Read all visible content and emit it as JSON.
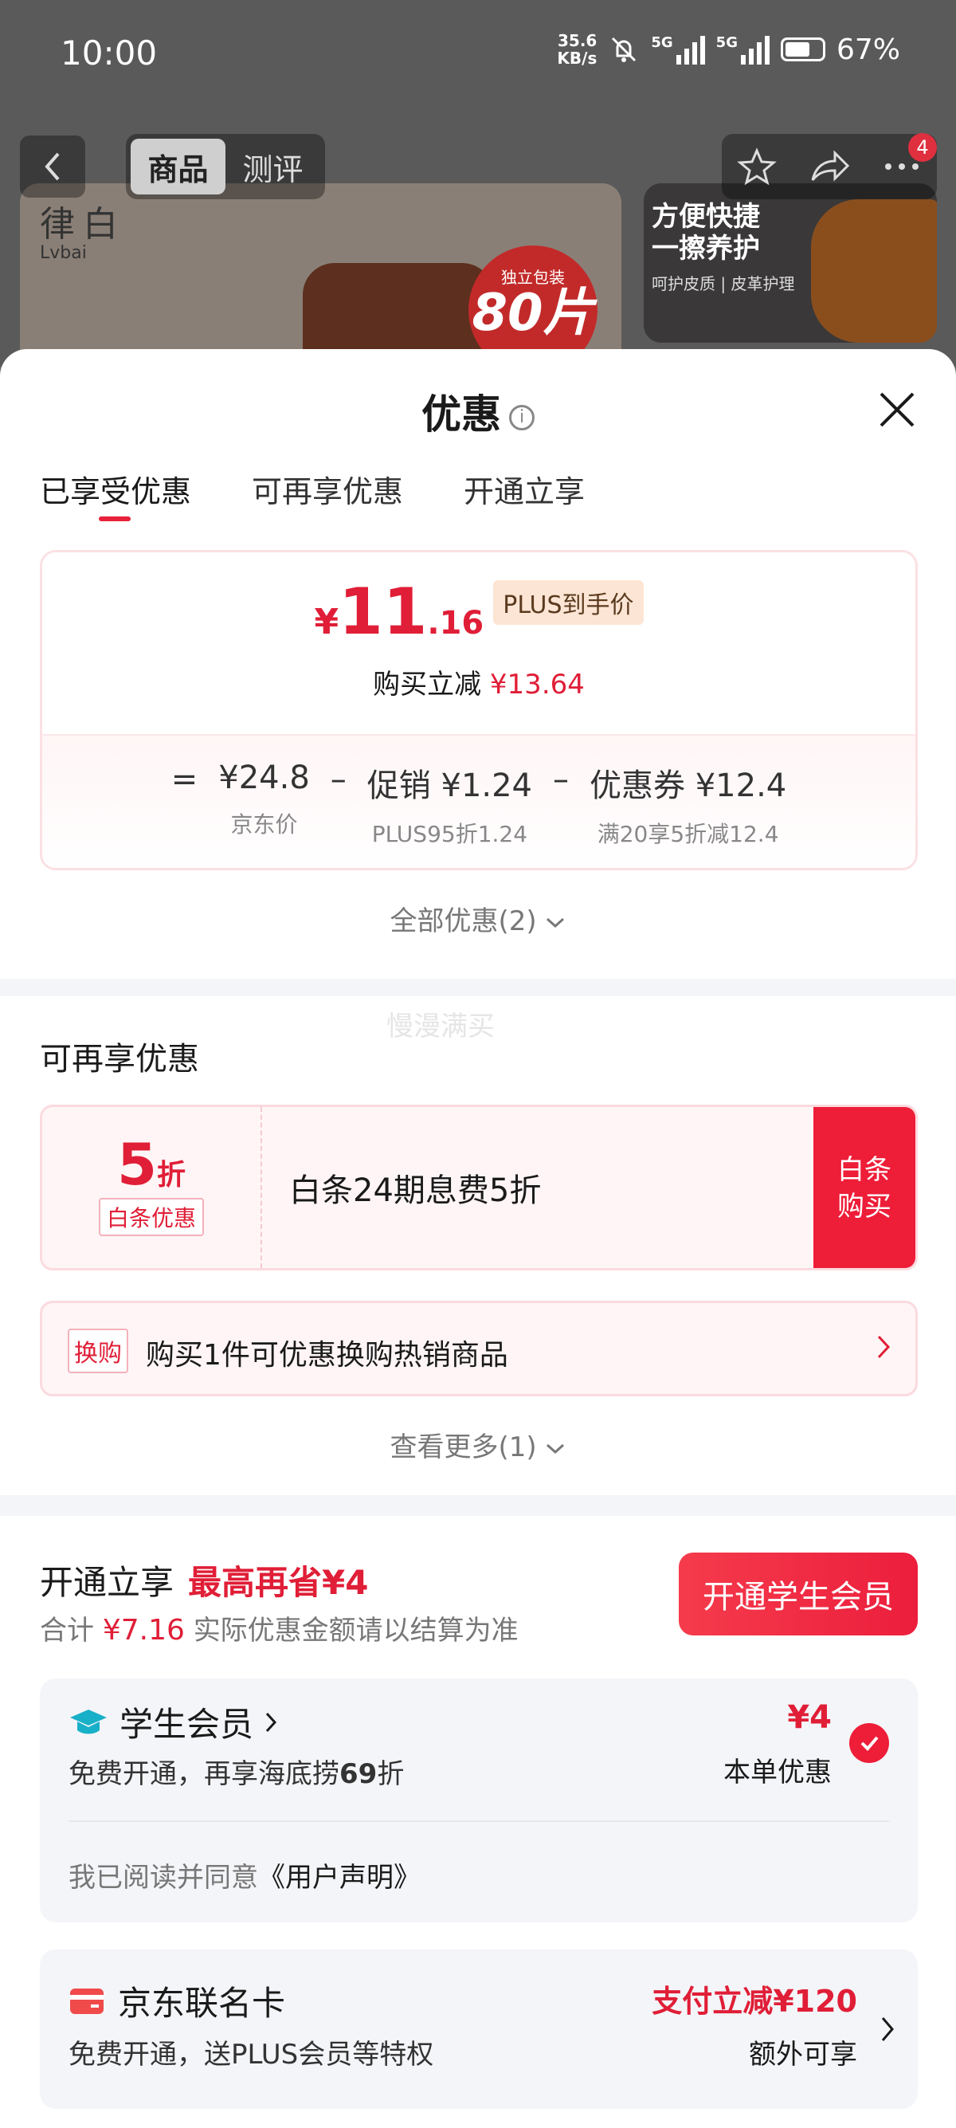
{
  "status_bar": {
    "time": "10:00",
    "net_speed_value": "35.6",
    "net_speed_unit": "KB/s",
    "sim1": "5G",
    "sim2": "5G",
    "battery": "67%"
  },
  "background_page": {
    "tabs": [
      "商品",
      "测评"
    ],
    "cart_badge": "4",
    "brand_cn": "律白",
    "brand_en": "Lvbai",
    "seal_line1": "独立包装",
    "seal_line2": "80片",
    "side_ad_line1": "方便快捷",
    "side_ad_line2": "一擦养护",
    "side_ad_line3": "呵护皮质 | 皮革护理"
  },
  "sheet": {
    "title": "优惠",
    "tabs": [
      "已享受优惠",
      "可再享优惠",
      "开通立享"
    ],
    "active_tab": 0,
    "price": {
      "currency": "¥",
      "integer": "11",
      "decimal": ".16",
      "tag": "PLUS到手价",
      "reduce_label": "购买立减",
      "reduce_amount": "¥13.64"
    },
    "formula": {
      "eq": "=",
      "minus": "–",
      "terms": [
        {
          "value": "¥24.8",
          "label": "京东价"
        },
        {
          "value": "促销 ¥1.24",
          "label": "PLUS95折1.24"
        },
        {
          "value": "优惠券 ¥12.4",
          "label": "满20享5折减12.4"
        }
      ]
    },
    "all_deals": "全部优惠(2)",
    "watermark": "慢漫满买",
    "more_section": {
      "title": "可再享优惠",
      "baitiao": {
        "discount": "5",
        "unit": "折",
        "tag": "白条优惠",
        "desc": "白条24期息费5折",
        "button": "白条购买"
      },
      "swap": {
        "tag": "换购",
        "text": "购买1件可优惠换购热销商品"
      },
      "see_more": "查看更多(1)"
    },
    "open_section": {
      "title": "开通立享",
      "max_save": "最高再省¥4",
      "sub_prefix": "合计",
      "sub_amount": "¥7.16",
      "sub_suffix": "实际优惠金额请以结算为准",
      "button": "开通学生会员",
      "student": {
        "name": "学生会员",
        "desc_prefix": "免费开通，再享海底捞",
        "desc_bold": "69",
        "desc_suffix": "折",
        "amount": "¥4",
        "amount_label": "本单优惠",
        "agree_prefix": "我已阅读并同意",
        "agree_link": "《用户声明》"
      },
      "jd_card": {
        "name": "京东联名卡",
        "desc": "免费开通，送PLUS会员等特权",
        "amount": "支付立减¥120",
        "amount_label": "额外可享"
      }
    }
  },
  "colors": {
    "accent": "#e01e37",
    "button": "#ee1d38",
    "card_bg": "#f4f5f8",
    "pink_bg": "#fff5f6"
  }
}
